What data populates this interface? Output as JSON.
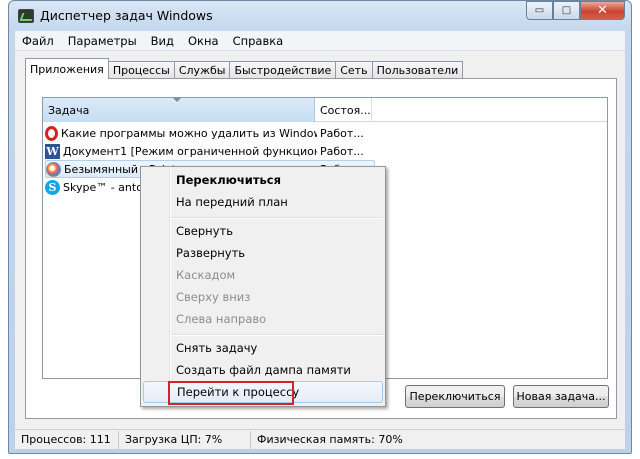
{
  "window": {
    "title": "Диспетчер задач Windows",
    "minimize_glyph": "▭",
    "maximize_glyph": "□",
    "close_glyph": "✕"
  },
  "menu": {
    "items": [
      "Файл",
      "Параметры",
      "Вид",
      "Окна",
      "Справка"
    ]
  },
  "tabs": {
    "items": [
      "Приложения",
      "Процессы",
      "Службы",
      "Быстродействие",
      "Сеть",
      "Пользователи"
    ],
    "active": "Приложения"
  },
  "list": {
    "columns": {
      "task": "Задача",
      "state": "Состоя..."
    },
    "rows": [
      {
        "icon": "opera-icon",
        "task": "Какие программы можно удалить из Windows ...",
        "state": "Работ..."
      },
      {
        "icon": "word-icon",
        "icon_glyph": "W",
        "task": "Документ1 [Режим ограниченной функциона...",
        "state": "Работ..."
      },
      {
        "icon": "paint-icon",
        "task": "Безымянный - Paint",
        "state": "Работ...",
        "selected": true
      },
      {
        "icon": "skype-icon",
        "icon_glyph": "S",
        "task": "Skype™ - antox",
        "state": ""
      }
    ]
  },
  "buttons": {
    "switch": "Переключиться",
    "new_task": "Новая задача..."
  },
  "context_menu": {
    "switch_to": "Переключиться",
    "bring_to_front": "На передний план",
    "minimize": "Свернуть",
    "maximize": "Развернуть",
    "cascade": "Каскадом",
    "tile_vertical": "Сверху вниз",
    "tile_horizontal": "Слева направо",
    "end_task": "Снять задачу",
    "create_dump": "Создать файл дампа памяти",
    "go_to_process": "Перейти к процессу"
  },
  "status": {
    "processes": "Процессов: 111",
    "cpu": "Загрузка ЦП: 7%",
    "memory": "Физическая память: 70%"
  },
  "colors": {
    "highlight_border": "#d2222a",
    "selection": "#dbe9f8"
  }
}
